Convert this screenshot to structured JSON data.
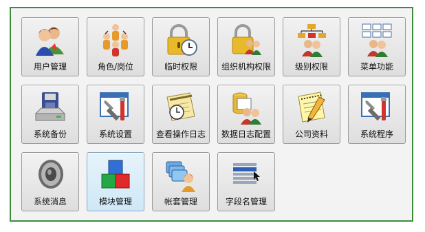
{
  "tiles": [
    {
      "label": "用户管理",
      "icon": "users-icon"
    },
    {
      "label": "角色/岗位",
      "icon": "roles-icon"
    },
    {
      "label": "临时权限",
      "icon": "temporary-permission-icon"
    },
    {
      "label": "组织机构权限",
      "icon": "organization-permission-icon"
    },
    {
      "label": "级别权限",
      "icon": "level-permission-icon"
    },
    {
      "label": "菜单功能",
      "icon": "menu-function-icon"
    },
    {
      "label": "系统备份",
      "icon": "backup-icon"
    },
    {
      "label": "系统设置",
      "icon": "settings-icon"
    },
    {
      "label": "查看操作日志",
      "icon": "operation-log-icon"
    },
    {
      "label": "数据日志配置",
      "icon": "data-log-config-icon"
    },
    {
      "label": "公司资料",
      "icon": "company-info-icon"
    },
    {
      "label": "系统程序",
      "icon": "system-program-icon"
    },
    {
      "label": "系统消息",
      "icon": "speaker-icon"
    },
    {
      "label": "模块管理",
      "icon": "modules-icon"
    },
    {
      "label": "帐套管理",
      "icon": "account-sets-icon"
    },
    {
      "label": "字段名管理",
      "icon": "field-names-icon"
    }
  ],
  "selected_tile": "模块管理",
  "colors": {
    "frame_border": "#3c8c3c",
    "tile_selected_bg": "#cfe8f7"
  }
}
